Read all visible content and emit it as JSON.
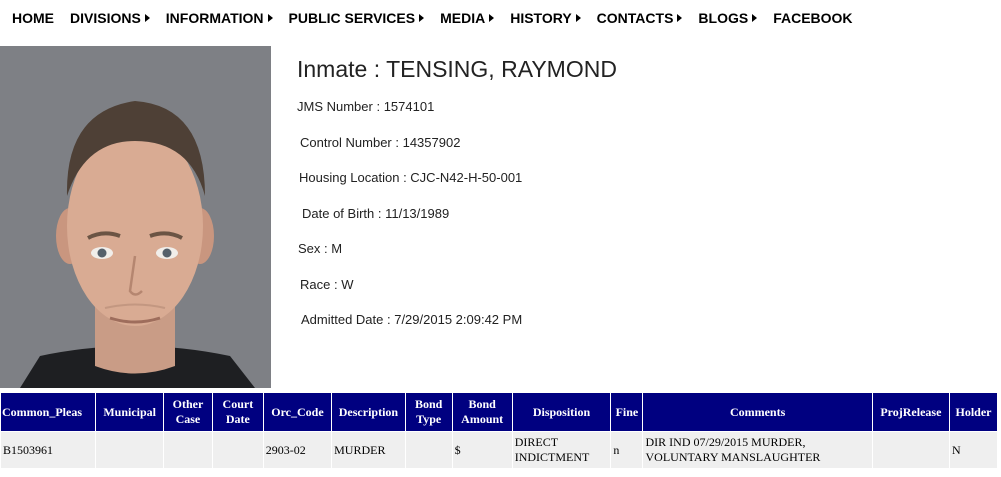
{
  "nav": {
    "items": [
      {
        "label": "HOME",
        "has_submenu": false
      },
      {
        "label": "DIVISIONS",
        "has_submenu": true
      },
      {
        "label": "INFORMATION",
        "has_submenu": true
      },
      {
        "label": "PUBLIC SERVICES",
        "has_submenu": true
      },
      {
        "label": "MEDIA",
        "has_submenu": true
      },
      {
        "label": "HISTORY",
        "has_submenu": true
      },
      {
        "label": "CONTACTS",
        "has_submenu": true
      },
      {
        "label": "BLOGS",
        "has_submenu": true
      },
      {
        "label": "FACEBOOK",
        "has_submenu": false
      }
    ]
  },
  "inmate": {
    "name_line": "Inmate : TENSING, RAYMOND",
    "fields": [
      {
        "label": "JMS Number : ",
        "value": "1574101"
      },
      {
        "label": "Control Number : ",
        "value": "14357902"
      },
      {
        "label": "Housing Location : ",
        "value": "CJC-N42-H-50-001"
      },
      {
        "label": "Date of Birth : ",
        "value": "11/13/1989"
      },
      {
        "label": "Sex : ",
        "value": "M"
      },
      {
        "label": "Race : ",
        "value": "W"
      },
      {
        "label": "Admitted Date : ",
        "value": "7/29/2015 2:09:42 PM"
      }
    ]
  },
  "charges": {
    "headers": [
      "Common_Pleas",
      "Municipal",
      "Other Case",
      "Court Date",
      "Orc_Code",
      "Description",
      "Bond Type",
      "Bond Amount",
      "Disposition",
      "Fine",
      "Comments",
      "ProjRelease",
      "Holder"
    ],
    "rows": [
      [
        "B1503961",
        "",
        "",
        "",
        "2903-02",
        "MURDER",
        "",
        "$",
        "DIRECT INDICTMENT",
        "n",
        "DIR IND 07/29/2015 MURDER, VOLUNTARY MANSLAUGHTER",
        "",
        "N"
      ]
    ]
  },
  "colors": {
    "table_header_bg": "#000080",
    "table_row_bg": "#efefef",
    "photo_bg": "#7d7f84"
  }
}
